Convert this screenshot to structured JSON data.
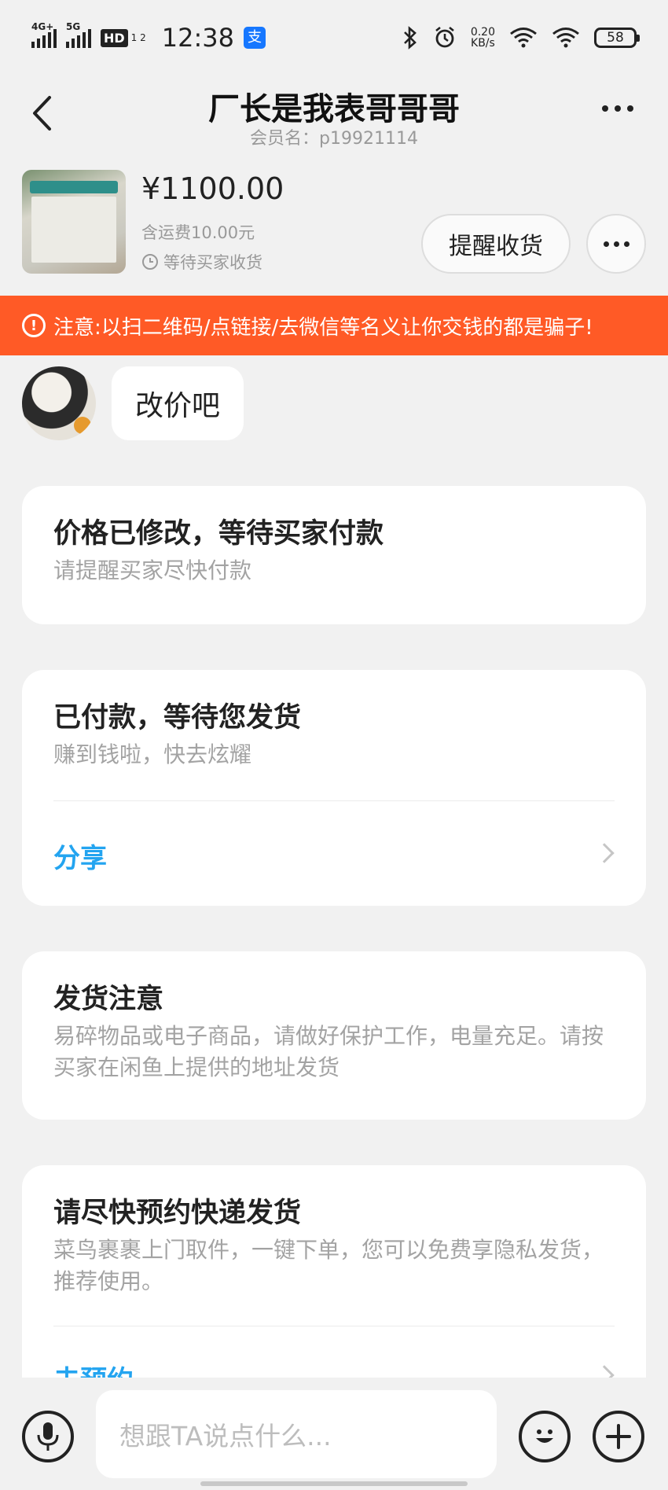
{
  "status_bar": {
    "network1": "4G+",
    "network2": "5G",
    "hd_label": "HD",
    "hd_sub": "1 2",
    "time": "12:38",
    "speed_value": "0.20",
    "speed_unit": "KB/s",
    "battery": "58"
  },
  "header": {
    "title": "厂长是我表哥哥哥",
    "member": "会员名：p19921114"
  },
  "product": {
    "price": "¥1100.00",
    "shipping": "含运费10.00元",
    "status": "等待买家收货",
    "remind_button": "提醒收货"
  },
  "warning": {
    "text": "注意:以扫二维码/点链接/去微信等名义让你交钱的都是骗子!"
  },
  "messages": [
    {
      "text": "改价吧"
    }
  ],
  "cards": {
    "price_changed": {
      "title": "价格已修改，等待买家付款",
      "text": "请提醒买家尽快付款"
    },
    "paid": {
      "title": "已付款，等待您发货",
      "text": "赚到钱啦，快去炫耀",
      "link": "分享"
    },
    "shipping_notice": {
      "title": "发货注意",
      "text": "易碎物品或电子商品，请做好保护工作，电量充足。请按买家在闲鱼上提供的地址发货"
    },
    "book_delivery": {
      "title": "请尽快预约快递发货",
      "text": "菜鸟裹裹上门取件，一键下单，您可以免费享隐私发货，推荐使用。",
      "link": "去预约"
    }
  },
  "input_bar": {
    "placeholder": "想跟TA说点什么..."
  }
}
